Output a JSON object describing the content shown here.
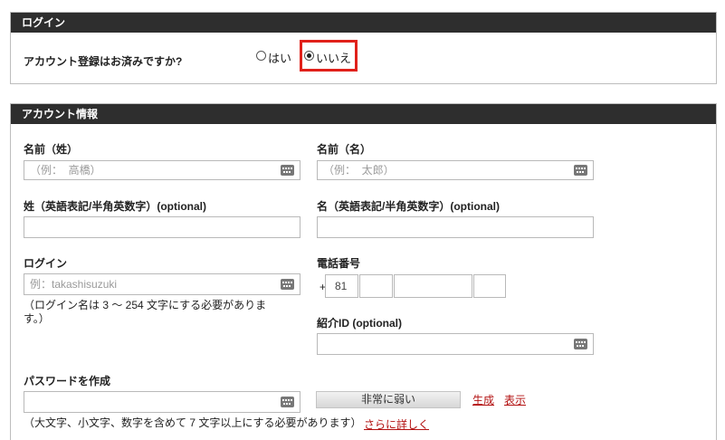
{
  "login_panel": {
    "title": "ログイン",
    "question": "アカウント登録はお済みですか?",
    "options": [
      {
        "label": "はい",
        "selected": false
      },
      {
        "label": "いいえ",
        "selected": true
      }
    ],
    "highlight_color": "#e0201a"
  },
  "account_panel": {
    "title": "アカウント情報",
    "last_name": {
      "label": "名前（姓）",
      "placeholder": "（例：  高橋）"
    },
    "first_name": {
      "label": "名前（名）",
      "placeholder": "（例：  太郎）"
    },
    "last_name_en": {
      "label": "姓（英語表記/半角英数字）(optional)",
      "placeholder": ""
    },
    "first_name_en": {
      "label": "名（英語表記/半角英数字）(optional)",
      "placeholder": ""
    },
    "login": {
      "label": "ログイン",
      "placeholder": "例：takashisuzuki",
      "note": "（ログイン名は 3 ～ 254 文字にする必要がありま す。）"
    },
    "phone": {
      "label": "電話番号",
      "prefix": "+",
      "country_code": "81"
    },
    "referral_id": {
      "label": "紹介ID (optional)",
      "placeholder": ""
    },
    "password": {
      "label": "パスワードを作成",
      "strength": "非常に弱い",
      "generate_link": "生成",
      "show_link": "表示",
      "note": "（大文字、小文字、数字を含めて 7 文字以上にする必要があります）",
      "more_link": "さらに詳しく"
    }
  },
  "colors": {
    "header_bg": "#2e2e2e",
    "link": "#b31212",
    "border": "#b9b9b9"
  }
}
